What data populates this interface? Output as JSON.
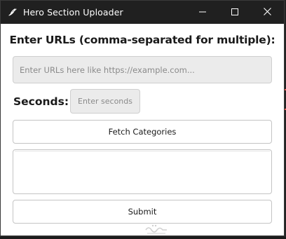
{
  "window": {
    "title": "Hero Section Uploader",
    "icons": {
      "app": "feather-icon",
      "minimize": "minimize-icon",
      "maximize": "maximize-icon",
      "close": "close-icon"
    }
  },
  "form": {
    "heading": "Enter URLs (comma-separated for multiple):",
    "urls_input": {
      "value": "",
      "placeholder": "Enter URLs here like https://example.com..."
    },
    "seconds_label": "Seconds:",
    "seconds_input": {
      "value": "",
      "placeholder": "Enter seconds"
    },
    "fetch_button_label": "Fetch Categories",
    "categories_list": [],
    "submit_button_label": "Submit"
  },
  "colors": {
    "titlebar": "#202020",
    "window_bg": "#ffffff",
    "input_bg": "#ebebeb",
    "border": "#c4c4c4"
  }
}
